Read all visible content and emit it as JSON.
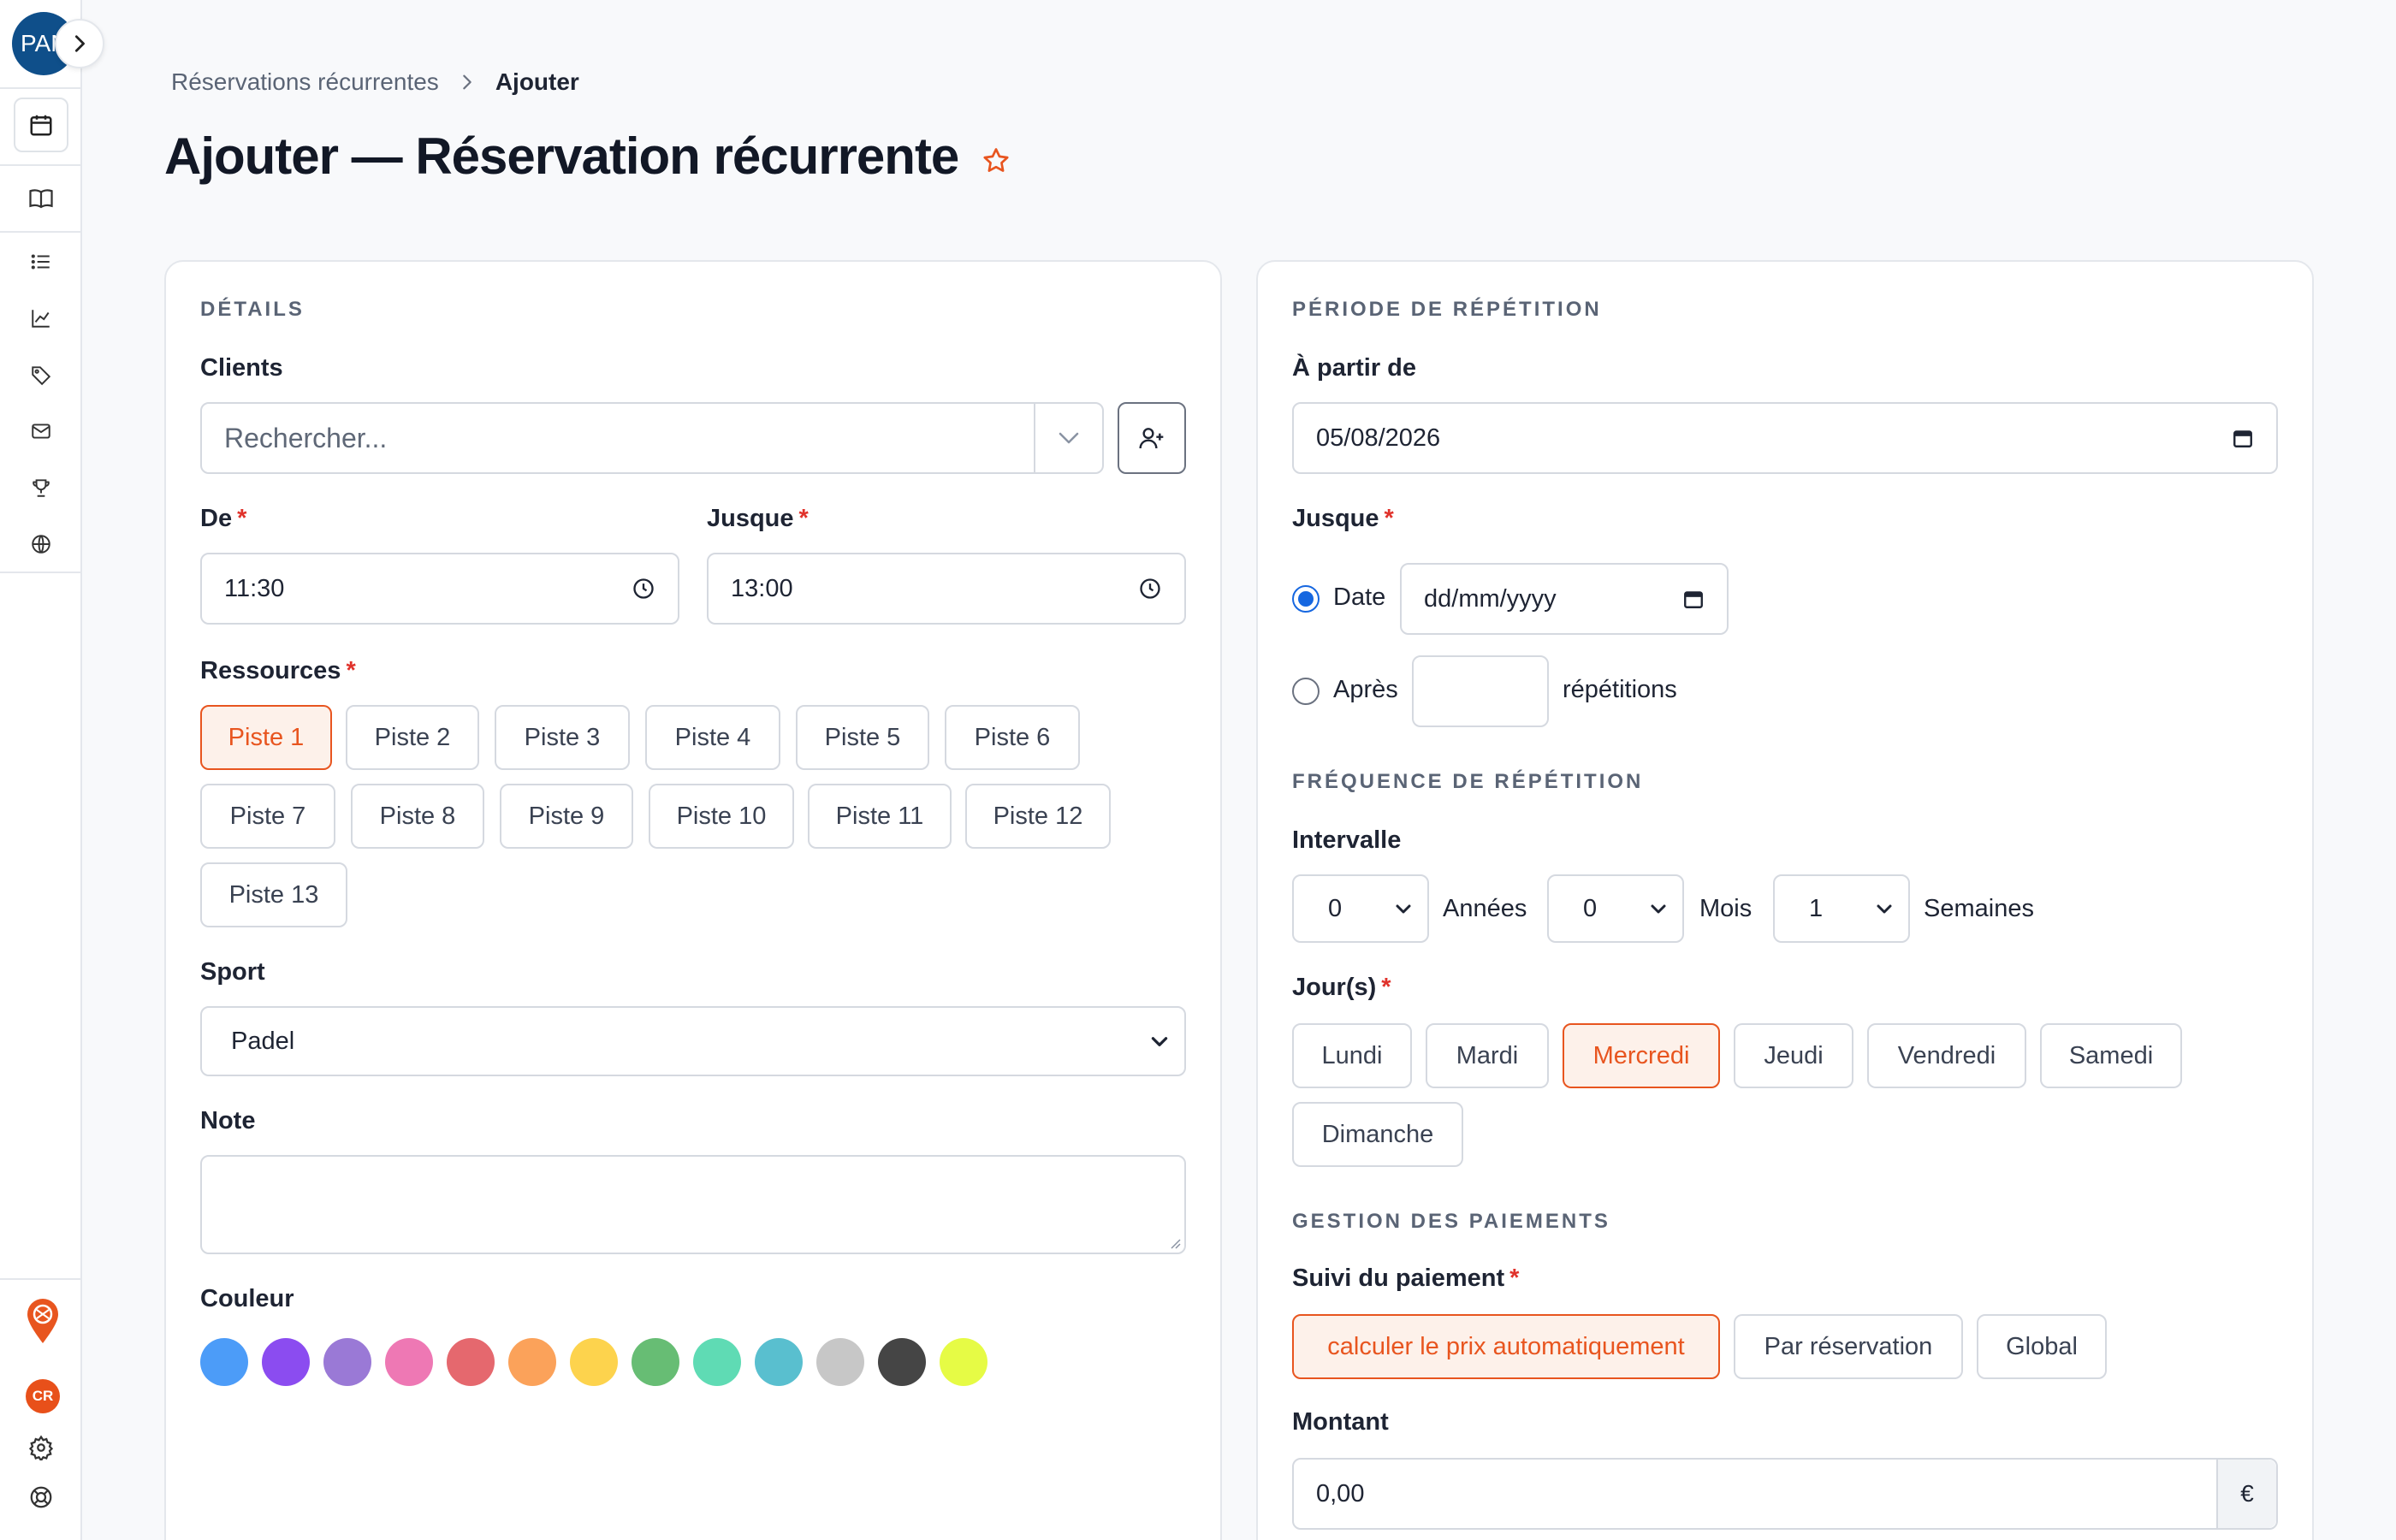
{
  "sidebar": {
    "avatar_text": "PAN",
    "user_initials": "CR",
    "nav": [
      "calendar-icon",
      "book-icon",
      "list-icon",
      "chart-icon",
      "tag-icon",
      "mail-icon",
      "trophy-icon",
      "globe-icon"
    ]
  },
  "breadcrumb": {
    "parent": "Réservations récurrentes",
    "current": "Ajouter"
  },
  "page": {
    "title": "Ajouter — Réservation récurrente"
  },
  "details": {
    "section_title": "DÉTAILS",
    "clients_label": "Clients",
    "clients_placeholder": "Rechercher...",
    "from_label": "De",
    "from_value": "11:30",
    "until_label": "Jusque",
    "until_value": "13:00",
    "resources_label": "Ressources",
    "resources": [
      "Piste 1",
      "Piste 2",
      "Piste 3",
      "Piste 4",
      "Piste 5",
      "Piste 6",
      "Piste 7",
      "Piste 8",
      "Piste 9",
      "Piste 10",
      "Piste 11",
      "Piste 12",
      "Piste 13"
    ],
    "resource_selected": "Piste 1",
    "sport_label": "Sport",
    "sport_value": "Padel",
    "note_label": "Note",
    "note_value": "",
    "color_label": "Couleur",
    "colors": [
      "#4c9cf8",
      "#8b4cf0",
      "#9a79d6",
      "#ee78b4",
      "#e5686e",
      "#fba25a",
      "#fdd34d",
      "#67bd74",
      "#5fdbb4",
      "#59bfcf",
      "#c7c7c7",
      "#454545",
      "#e6fb45"
    ]
  },
  "repeat": {
    "section_title": "PÉRIODE DE RÉPÉTITION",
    "start_label": "À partir de",
    "start_value": "05/08/2026",
    "until_label": "Jusque",
    "option_date": "Date",
    "date_placeholder": "dd/mm/yyyy",
    "option_after": "Après",
    "after_value": "",
    "repetitions_text": "répétitions"
  },
  "frequency": {
    "section_title": "FRÉQUENCE DE RÉPÉTITION",
    "interval_label": "Intervalle",
    "years_value": "0",
    "years_text": "Années",
    "months_value": "0",
    "months_text": "Mois",
    "weeks_value": "1",
    "weeks_text": "Semaines",
    "days_label": "Jour(s)",
    "days": [
      "Lundi",
      "Mardi",
      "Mercredi",
      "Jeudi",
      "Vendredi",
      "Samedi",
      "Dimanche"
    ],
    "day_selected": "Mercredi"
  },
  "payment": {
    "section_title": "GESTION DES PAIEMENTS",
    "tracking_label": "Suivi du paiement",
    "options": [
      "calculer le prix automatiquement",
      "Par réservation",
      "Global"
    ],
    "option_selected": "calculer le prix automatiquement",
    "amount_label": "Montant",
    "amount_value": "0,00",
    "currency": "€"
  },
  "colors": {
    "accent": "#e8551f",
    "radio": "#1667e0",
    "required": "#e0322b"
  }
}
